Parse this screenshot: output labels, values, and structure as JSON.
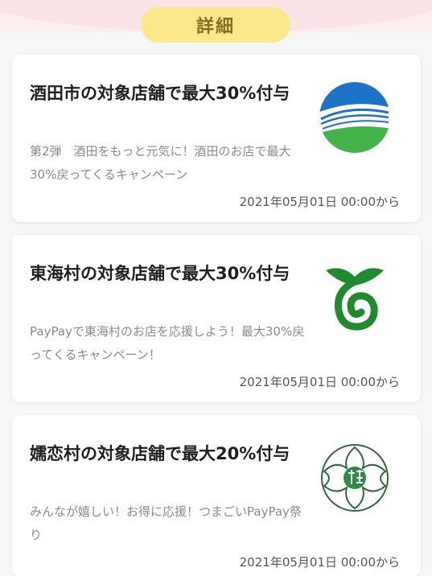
{
  "header": {
    "title": "詳細"
  },
  "cards": [
    {
      "title": "酒田市の対象店舗で最大30%付与",
      "description": "第2弾　酒田をもっと元気に！酒田のお店で最大30%戻ってくるキャンペーン",
      "date": "2021年05月01日 00:00から",
      "logo_icon": "sakata-city-emblem-icon"
    },
    {
      "title": "東海村の対象店舗で最大30%付与",
      "description": "PayPayで東海村のお店を応援しよう！最大30%戻ってくるキャンペーン！",
      "date": "2021年05月01日 00:00から",
      "logo_icon": "tokai-village-emblem-icon"
    },
    {
      "title": "嬬恋村の対象店舗で最大20%付与",
      "description": "みんなが嬉しい！お得に応援！つまごいPayPay祭り",
      "date": "2021年05月01日 00:00から",
      "logo_icon": "tsumagoi-village-emblem-icon"
    }
  ],
  "colors": {
    "pill": "#fbe88a",
    "pill_text": "#8a6a22",
    "tokai_green": "#1f8a2e"
  }
}
